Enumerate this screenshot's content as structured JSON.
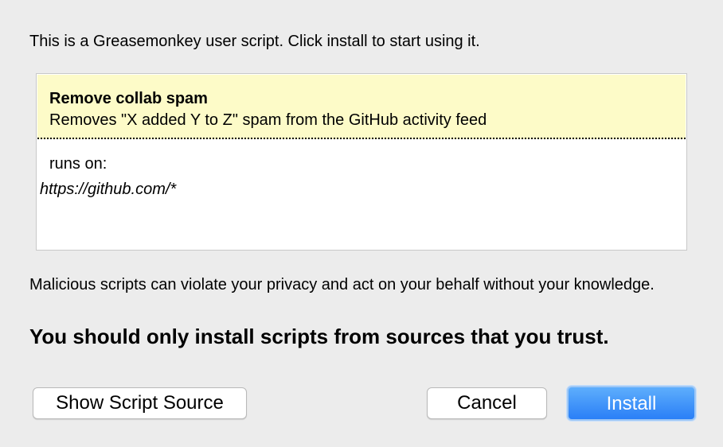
{
  "dialog": {
    "intro_text": "This is a Greasemonkey user script. Click install to start using it.",
    "script": {
      "name": "Remove collab spam",
      "description": "Removes \"X added Y to Z\" spam from the GitHub activity feed",
      "runs_on_label": "runs on:",
      "runs_on_url": "https://github.com/*",
      "header_color": "#fdfbc8"
    },
    "warning_text": "Malicious scripts can violate your privacy and act on your behalf without your knowledge.",
    "trust_text": "You should only install scripts from sources that you trust.",
    "buttons": {
      "show_source": "Show Script Source",
      "cancel": "Cancel",
      "install": "Install"
    },
    "accent_color": "#2a7ff7"
  }
}
